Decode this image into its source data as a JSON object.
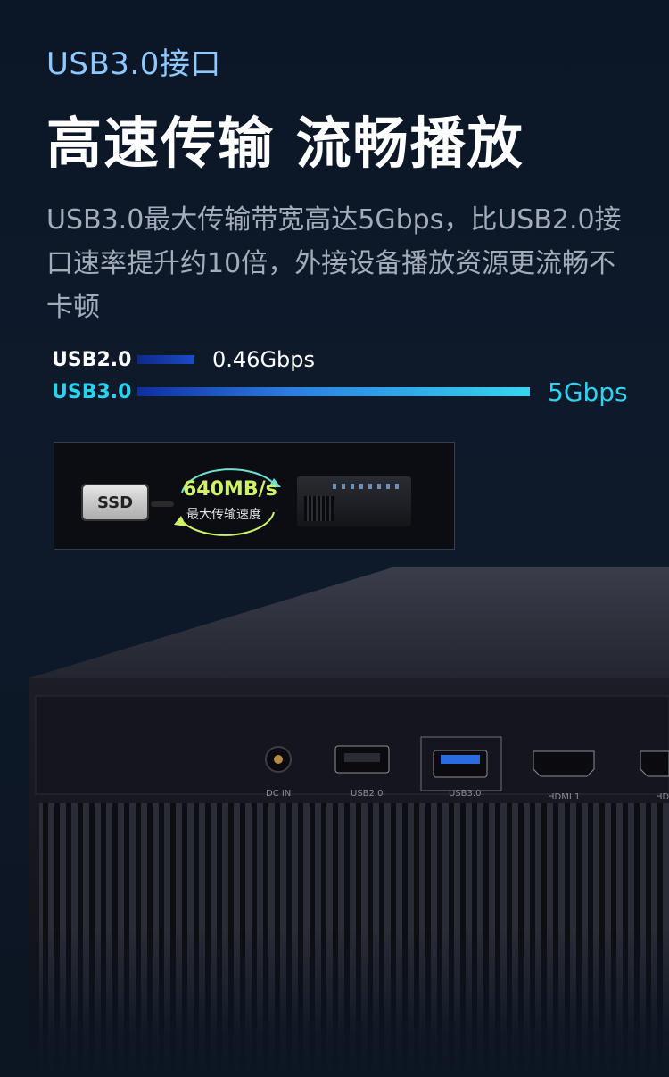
{
  "eyebrow": "USB3.0接口",
  "headline": "高速传输 流畅播放",
  "description": "USB3.0最大传输带宽高达5Gbps，比USB2.0接口速率提升约10倍，外接设备播放资源更流畅不卡顿",
  "comparison": {
    "rows": [
      {
        "label": "USB2.0",
        "value": "0.46Gbps",
        "speed": 0.46
      },
      {
        "label": "USB3.0",
        "value": "5Gbps",
        "speed": 5
      }
    ]
  },
  "speed_card": {
    "ssd_label": "SSD",
    "speed": "640MB/s",
    "caption": "最大传输速度"
  },
  "ports": [
    {
      "label": "DC IN"
    },
    {
      "label": "USB2.0"
    },
    {
      "label": "USB3.0"
    },
    {
      "label": "HDMI 1"
    },
    {
      "label": "HD"
    }
  ],
  "colors": {
    "accent": "#2fd3f1",
    "eyebrow": "#8fc7ff",
    "speed": "#cff26a"
  }
}
